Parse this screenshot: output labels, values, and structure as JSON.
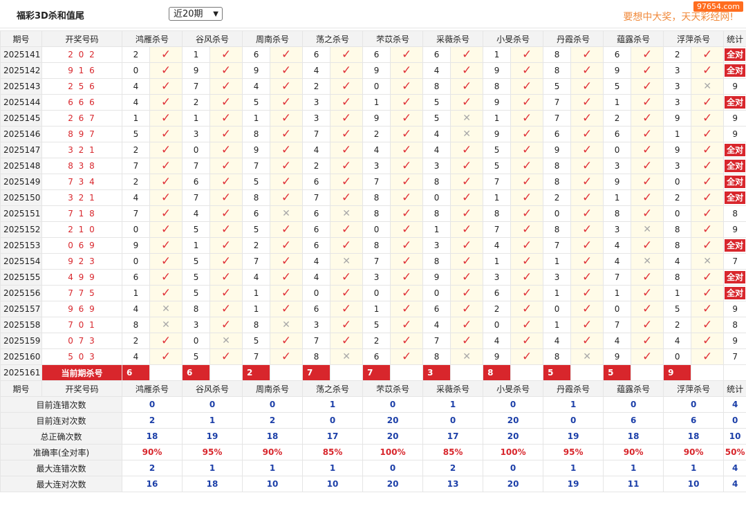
{
  "header": {
    "title": "福彩3D杀和值尾",
    "period_select": "近20期",
    "slogan": "要想中大奖，天天彩经网!",
    "watermark": "97654.com"
  },
  "columns": {
    "period": "期号",
    "draw": "开奖号码",
    "stat": "统计"
  },
  "predictors": [
    "鸿雁杀号",
    "谷风杀号",
    "周南杀号",
    "荡之杀号",
    "芣苡杀号",
    "采薇杀号",
    "小旻杀号",
    "丹霞杀号",
    "蕴露杀号",
    "浮萍杀号"
  ],
  "rows": [
    {
      "period": "2025141",
      "draw": "2 0 2",
      "picks": [
        [
          2,
          1
        ],
        [
          1,
          1
        ],
        [
          6,
          1
        ],
        [
          6,
          1
        ],
        [
          6,
          1
        ],
        [
          6,
          1
        ],
        [
          1,
          1
        ],
        [
          8,
          1
        ],
        [
          6,
          1
        ],
        [
          2,
          1
        ]
      ],
      "stat": "全对"
    },
    {
      "period": "2025142",
      "draw": "9 1 6",
      "picks": [
        [
          0,
          1
        ],
        [
          9,
          1
        ],
        [
          9,
          1
        ],
        [
          4,
          1
        ],
        [
          9,
          1
        ],
        [
          4,
          1
        ],
        [
          9,
          1
        ],
        [
          8,
          1
        ],
        [
          9,
          1
        ],
        [
          3,
          1
        ]
      ],
      "stat": "全对"
    },
    {
      "period": "2025143",
      "draw": "2 5 6",
      "picks": [
        [
          4,
          1
        ],
        [
          7,
          1
        ],
        [
          4,
          1
        ],
        [
          2,
          1
        ],
        [
          0,
          1
        ],
        [
          8,
          1
        ],
        [
          8,
          1
        ],
        [
          5,
          1
        ],
        [
          5,
          1
        ],
        [
          3,
          0
        ]
      ],
      "stat": "9"
    },
    {
      "period": "2025144",
      "draw": "6 6 6",
      "picks": [
        [
          4,
          1
        ],
        [
          2,
          1
        ],
        [
          5,
          1
        ],
        [
          3,
          1
        ],
        [
          1,
          1
        ],
        [
          5,
          1
        ],
        [
          9,
          1
        ],
        [
          7,
          1
        ],
        [
          1,
          1
        ],
        [
          3,
          1
        ]
      ],
      "stat": "全对"
    },
    {
      "period": "2025145",
      "draw": "2 6 7",
      "picks": [
        [
          1,
          1
        ],
        [
          1,
          1
        ],
        [
          1,
          1
        ],
        [
          3,
          1
        ],
        [
          9,
          1
        ],
        [
          5,
          0
        ],
        [
          1,
          1
        ],
        [
          7,
          1
        ],
        [
          2,
          1
        ],
        [
          9,
          1
        ]
      ],
      "stat": "9"
    },
    {
      "period": "2025146",
      "draw": "8 9 7",
      "picks": [
        [
          5,
          1
        ],
        [
          3,
          1
        ],
        [
          8,
          1
        ],
        [
          7,
          1
        ],
        [
          2,
          1
        ],
        [
          4,
          0
        ],
        [
          9,
          1
        ],
        [
          6,
          1
        ],
        [
          6,
          1
        ],
        [
          1,
          1
        ]
      ],
      "stat": "9"
    },
    {
      "period": "2025147",
      "draw": "3 2 1",
      "picks": [
        [
          2,
          1
        ],
        [
          0,
          1
        ],
        [
          9,
          1
        ],
        [
          4,
          1
        ],
        [
          4,
          1
        ],
        [
          4,
          1
        ],
        [
          5,
          1
        ],
        [
          9,
          1
        ],
        [
          0,
          1
        ],
        [
          9,
          1
        ]
      ],
      "stat": "全对"
    },
    {
      "period": "2025148",
      "draw": "8 3 8",
      "picks": [
        [
          7,
          1
        ],
        [
          7,
          1
        ],
        [
          7,
          1
        ],
        [
          2,
          1
        ],
        [
          3,
          1
        ],
        [
          3,
          1
        ],
        [
          5,
          1
        ],
        [
          8,
          1
        ],
        [
          3,
          1
        ],
        [
          3,
          1
        ]
      ],
      "stat": "全对"
    },
    {
      "period": "2025149",
      "draw": "7 3 4",
      "picks": [
        [
          2,
          1
        ],
        [
          6,
          1
        ],
        [
          5,
          1
        ],
        [
          6,
          1
        ],
        [
          7,
          1
        ],
        [
          8,
          1
        ],
        [
          7,
          1
        ],
        [
          8,
          1
        ],
        [
          9,
          1
        ],
        [
          0,
          1
        ]
      ],
      "stat": "全对"
    },
    {
      "period": "2025150",
      "draw": "3 2 1",
      "picks": [
        [
          4,
          1
        ],
        [
          7,
          1
        ],
        [
          8,
          1
        ],
        [
          7,
          1
        ],
        [
          8,
          1
        ],
        [
          0,
          1
        ],
        [
          1,
          1
        ],
        [
          2,
          1
        ],
        [
          1,
          1
        ],
        [
          2,
          1
        ]
      ],
      "stat": "全对"
    },
    {
      "period": "2025151",
      "draw": "7 1 8",
      "picks": [
        [
          7,
          1
        ],
        [
          4,
          1
        ],
        [
          6,
          0
        ],
        [
          6,
          0
        ],
        [
          8,
          1
        ],
        [
          8,
          1
        ],
        [
          8,
          1
        ],
        [
          0,
          1
        ],
        [
          8,
          1
        ],
        [
          0,
          1
        ]
      ],
      "stat": "8"
    },
    {
      "period": "2025152",
      "draw": "2 1 0",
      "picks": [
        [
          0,
          1
        ],
        [
          5,
          1
        ],
        [
          5,
          1
        ],
        [
          6,
          1
        ],
        [
          0,
          1
        ],
        [
          1,
          1
        ],
        [
          7,
          1
        ],
        [
          8,
          1
        ],
        [
          3,
          0
        ],
        [
          8,
          1
        ]
      ],
      "stat": "9"
    },
    {
      "period": "2025153",
      "draw": "0 6 9",
      "picks": [
        [
          9,
          1
        ],
        [
          1,
          1
        ],
        [
          2,
          1
        ],
        [
          6,
          1
        ],
        [
          8,
          1
        ],
        [
          3,
          1
        ],
        [
          4,
          1
        ],
        [
          7,
          1
        ],
        [
          4,
          1
        ],
        [
          8,
          1
        ]
      ],
      "stat": "全对"
    },
    {
      "period": "2025154",
      "draw": "9 2 3",
      "picks": [
        [
          0,
          1
        ],
        [
          5,
          1
        ],
        [
          7,
          1
        ],
        [
          4,
          0
        ],
        [
          7,
          1
        ],
        [
          8,
          1
        ],
        [
          1,
          1
        ],
        [
          1,
          1
        ],
        [
          4,
          0
        ],
        [
          4,
          0
        ]
      ],
      "stat": "7"
    },
    {
      "period": "2025155",
      "draw": "4 9 9",
      "picks": [
        [
          6,
          1
        ],
        [
          5,
          1
        ],
        [
          4,
          1
        ],
        [
          4,
          1
        ],
        [
          3,
          1
        ],
        [
          9,
          1
        ],
        [
          3,
          1
        ],
        [
          3,
          1
        ],
        [
          7,
          1
        ],
        [
          8,
          1
        ]
      ],
      "stat": "全对"
    },
    {
      "period": "2025156",
      "draw": "7 7 5",
      "picks": [
        [
          1,
          1
        ],
        [
          5,
          1
        ],
        [
          1,
          1
        ],
        [
          0,
          1
        ],
        [
          0,
          1
        ],
        [
          0,
          1
        ],
        [
          6,
          1
        ],
        [
          1,
          1
        ],
        [
          1,
          1
        ],
        [
          1,
          1
        ]
      ],
      "stat": "全对"
    },
    {
      "period": "2025157",
      "draw": "9 6 9",
      "picks": [
        [
          4,
          0
        ],
        [
          8,
          1
        ],
        [
          1,
          1
        ],
        [
          6,
          1
        ],
        [
          1,
          1
        ],
        [
          6,
          1
        ],
        [
          2,
          1
        ],
        [
          0,
          1
        ],
        [
          0,
          1
        ],
        [
          5,
          1
        ]
      ],
      "stat": "9"
    },
    {
      "period": "2025158",
      "draw": "7 0 1",
      "picks": [
        [
          8,
          0
        ],
        [
          3,
          1
        ],
        [
          8,
          0
        ],
        [
          3,
          1
        ],
        [
          5,
          1
        ],
        [
          4,
          1
        ],
        [
          0,
          1
        ],
        [
          1,
          1
        ],
        [
          7,
          1
        ],
        [
          2,
          1
        ]
      ],
      "stat": "8"
    },
    {
      "period": "2025159",
      "draw": "0 7 3",
      "picks": [
        [
          2,
          1
        ],
        [
          0,
          0
        ],
        [
          5,
          1
        ],
        [
          7,
          1
        ],
        [
          2,
          1
        ],
        [
          7,
          1
        ],
        [
          4,
          1
        ],
        [
          4,
          1
        ],
        [
          4,
          1
        ],
        [
          4,
          1
        ]
      ],
      "stat": "9"
    },
    {
      "period": "2025160",
      "draw": "5 0 3",
      "picks": [
        [
          4,
          1
        ],
        [
          5,
          1
        ],
        [
          7,
          1
        ],
        [
          8,
          0
        ],
        [
          6,
          1
        ],
        [
          8,
          0
        ],
        [
          9,
          1
        ],
        [
          8,
          0
        ],
        [
          9,
          1
        ],
        [
          0,
          1
        ]
      ],
      "stat": "7"
    }
  ],
  "current": {
    "period": "2025161",
    "label": "当前期杀号",
    "picks": [
      6,
      6,
      2,
      7,
      7,
      3,
      8,
      5,
      5,
      9
    ]
  },
  "stats": [
    {
      "label": "目前连错次数",
      "values": [
        "0",
        "0",
        "0",
        "1",
        "0",
        "1",
        "0",
        "1",
        "0",
        "0"
      ],
      "stat": "4",
      "style": "sv"
    },
    {
      "label": "目前连对次数",
      "values": [
        "2",
        "1",
        "2",
        "0",
        "20",
        "0",
        "20",
        "0",
        "6",
        "6"
      ],
      "stat": "0",
      "style": "sv"
    },
    {
      "label": "总正确次数",
      "values": [
        "18",
        "19",
        "18",
        "17",
        "20",
        "17",
        "20",
        "19",
        "18",
        "18"
      ],
      "stat": "10",
      "style": "sv"
    },
    {
      "label": "准确率(全对率)",
      "values": [
        "90%",
        "95%",
        "90%",
        "85%",
        "100%",
        "85%",
        "100%",
        "95%",
        "90%",
        "90%"
      ],
      "stat": "50%",
      "style": "sr"
    },
    {
      "label": "最大连错次数",
      "values": [
        "2",
        "1",
        "1",
        "1",
        "0",
        "2",
        "0",
        "1",
        "1",
        "1"
      ],
      "stat": "4",
      "style": "sv"
    },
    {
      "label": "最大连对次数",
      "values": [
        "16",
        "18",
        "10",
        "10",
        "20",
        "13",
        "20",
        "19",
        "11",
        "10"
      ],
      "stat": "4",
      "style": "sv"
    }
  ],
  "icons": {
    "correct": "check-icon",
    "wrong": "cross-icon"
  },
  "colors": {
    "red": "#d8262c",
    "blue": "#1c3fa8",
    "highlight": "#fffbe8"
  }
}
